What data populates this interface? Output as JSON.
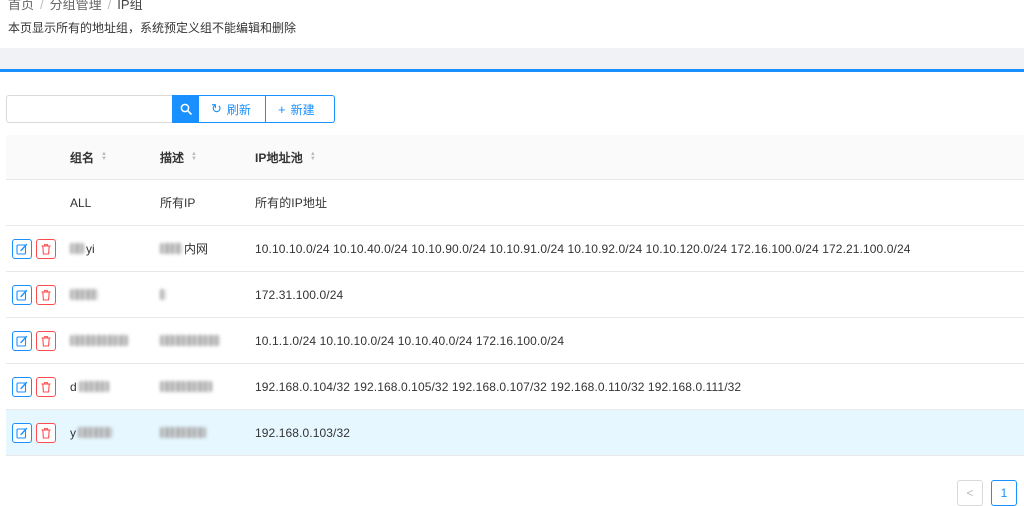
{
  "breadcrumb": {
    "home": "首页",
    "group_mgmt": "分组管理",
    "current": "IP组"
  },
  "subtitle": "本页显示所有的地址组，系统预定义组不能编辑和删除",
  "toolbar": {
    "search_value": "",
    "refresh_label": "刷新",
    "add_label": "新建"
  },
  "icons": {
    "search": "search-icon",
    "refresh": "refresh-icon",
    "add": "plus-icon",
    "edit": "edit-icon",
    "delete": "trash-icon"
  },
  "colors": {
    "accent": "#1890ff",
    "danger": "#ff4d4f",
    "selected_row": "#e6f7ff"
  },
  "table": {
    "headers": {
      "name": "组名",
      "desc": "描述",
      "pool": "IP地址池"
    },
    "rows": [
      {
        "name": "ALL",
        "desc": "所有IP",
        "pool": "所有的IP地址"
      },
      {
        "name": "yi",
        "desc": "内网",
        "pool": "10.10.10.0/24  10.10.40.0/24  10.10.90.0/24  10.10.91.0/24  10.10.92.0/24  10.10.120.0/24  172.16.100.0/24  172.21.100.0/24"
      },
      {
        "name": "",
        "desc": "",
        "pool": "172.31.100.0/24"
      },
      {
        "name": "",
        "desc": "",
        "pool": "10.1.1.0/24  10.10.10.0/24  10.10.40.0/24  172.16.100.0/24"
      },
      {
        "name": "d",
        "desc": "",
        "pool": "192.168.0.104/32  192.168.0.105/32  192.168.0.107/32  192.168.0.110/32  192.168.0.111/32"
      },
      {
        "name": "y",
        "desc": "",
        "pool": "192.168.0.103/32"
      }
    ]
  },
  "pagination": {
    "prev": "<",
    "current_page": "1"
  }
}
